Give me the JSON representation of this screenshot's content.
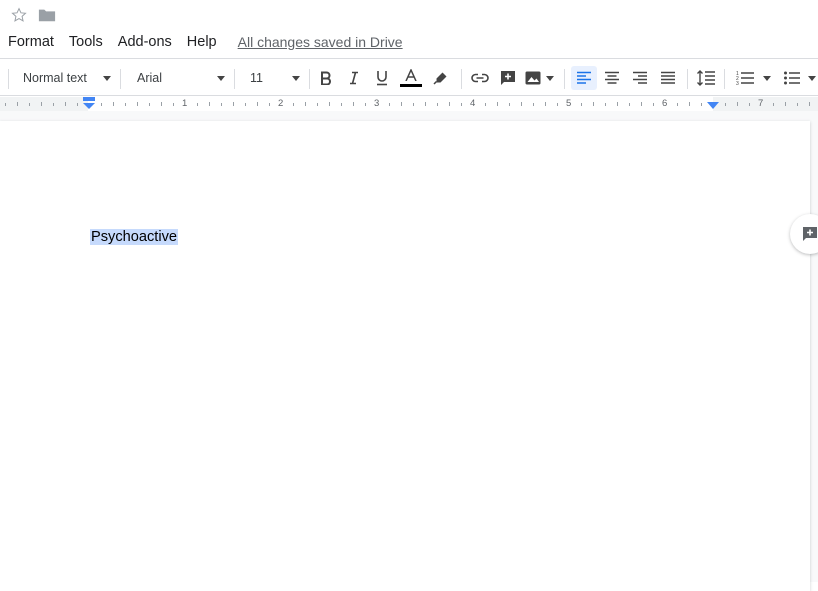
{
  "menu": {
    "items": [
      "Format",
      "Tools",
      "Add-ons",
      "Help"
    ],
    "saved_status": "All changes saved in Drive"
  },
  "toolbar": {
    "style": "Normal text",
    "font": "Arial",
    "size": "11",
    "text_color_bar": "#000000"
  },
  "ruler": {
    "numbers": [
      "1",
      "2",
      "3",
      "4",
      "5",
      "6",
      "7"
    ]
  },
  "document": {
    "text": "Psychoactive"
  },
  "colors": {
    "selection": "#c6dafc",
    "accent": "#1a73e8"
  }
}
